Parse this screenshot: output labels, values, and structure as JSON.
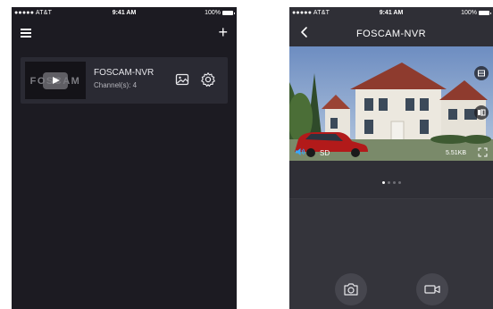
{
  "left_screen": {
    "status_bar": {
      "carrier": "●●●●● AT&T",
      "time": "9:41 AM",
      "battery": "100%"
    },
    "nav": {
      "menu_icon": "hamburger-menu-icon",
      "add_icon": "plus-icon",
      "add_label": "+"
    },
    "device": {
      "thumbnail_logo": "FOSCAM",
      "name": "FOSCAM-NVR",
      "channels": "Channel(s): 4",
      "icons": [
        "play-icon",
        "image-icon",
        "gear-icon"
      ]
    }
  },
  "right_screen": {
    "status_bar": {
      "carrier": "●●●●● AT&T",
      "time": "9:41 AM",
      "battery": "100%"
    },
    "nav": {
      "back_icon": "chevron-left-icon",
      "title": "FOSCAM-NVR"
    },
    "video": {
      "quality": "SD",
      "bitrate": "5.51KB",
      "icons": [
        "speaker-icon",
        "fullscreen-icon",
        "layout-icon",
        "mirror-icon"
      ]
    },
    "pager": {
      "pages": 4,
      "current": 1
    },
    "controls": {
      "icons": [
        "camera-icon",
        "video-camera-icon"
      ]
    }
  },
  "colors": {
    "left_background": "#1c1b22",
    "card_background": "#2a2a33",
    "right_background": "#2f2f36",
    "control_button": "#46464e",
    "active_dot": "#ffffff"
  }
}
